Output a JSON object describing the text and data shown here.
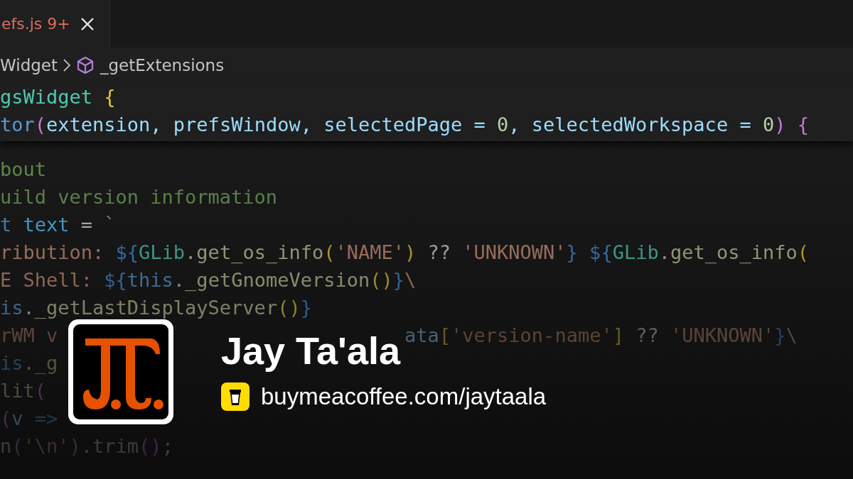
{
  "editor": {
    "tab": {
      "label": "efs.js 9+",
      "selected": true
    },
    "breadcrumb": [
      {
        "label": "Widget"
      },
      {
        "label": "_getExtensions"
      }
    ],
    "sticky_lines": [
      [
        {
          "text": "gsWidget ",
          "kind": "class"
        },
        {
          "text": "{",
          "kind": "brace"
        }
      ],
      [
        {
          "text": "tor",
          "kind": "keyword"
        },
        {
          "text": "(",
          "kind": "paren"
        },
        {
          "text": "extension, prefsWindow, selectedPage = ",
          "kind": "var"
        },
        {
          "text": "0",
          "kind": "num"
        },
        {
          "text": ", selectedWorkspace = ",
          "kind": "var"
        },
        {
          "text": "0",
          "kind": "num"
        },
        {
          "text": ") {",
          "kind": "paren"
        }
      ]
    ],
    "lines": [
      {
        "tokens": [
          {
            "text": "bout",
            "kind": "comment"
          }
        ]
      },
      {
        "tokens": [
          {
            "text": "uild version information",
            "kind": "comment"
          }
        ]
      },
      {
        "tokens": [
          {
            "text": "t",
            "kind": "keyword"
          },
          {
            "text": " text",
            "kind": "const"
          },
          {
            "text": " = ",
            "kind": "plain"
          },
          {
            "text": "`",
            "kind": "string"
          }
        ]
      },
      {
        "tokens": [
          {
            "text": "ribution: ",
            "kind": "string"
          },
          {
            "text": "${",
            "kind": "tmpl"
          },
          {
            "text": "GLib",
            "kind": "class"
          },
          {
            "text": ".get_os_info",
            "kind": "func"
          },
          {
            "text": "(",
            "kind": "brace"
          },
          {
            "text": "'NAME'",
            "kind": "string"
          },
          {
            "text": ")",
            "kind": "brace"
          },
          {
            "text": " ?? ",
            "kind": "plain"
          },
          {
            "text": "'UNKNOWN'",
            "kind": "string"
          },
          {
            "text": "} ${",
            "kind": "tmpl"
          },
          {
            "text": "GLib",
            "kind": "class"
          },
          {
            "text": ".get_os_info",
            "kind": "func"
          },
          {
            "text": "(",
            "kind": "brace"
          }
        ]
      },
      {
        "tokens": [
          {
            "text": "E Shell: ",
            "kind": "string"
          },
          {
            "text": "${",
            "kind": "tmpl"
          },
          {
            "text": "this",
            "kind": "keyword"
          },
          {
            "text": "._getGnomeVersion",
            "kind": "func"
          },
          {
            "text": "()",
            "kind": "brace"
          },
          {
            "text": "}",
            "kind": "tmpl"
          },
          {
            "text": "\\",
            "kind": "string"
          }
        ]
      },
      {
        "tokens": [
          {
            "text": "is",
            "kind": "keyword"
          },
          {
            "text": "._getLastDisplayServer",
            "kind": "func"
          },
          {
            "text": "()",
            "kind": "brace"
          },
          {
            "text": "}",
            "kind": "tmpl"
          }
        ]
      },
      {
        "tokens": [
          {
            "text": "rWM v",
            "kind": "string"
          }
        ],
        "right": [
          {
            "text": "ata",
            "kind": "var"
          },
          {
            "text": "[",
            "kind": "brace"
          },
          {
            "text": "'version-name'",
            "kind": "string"
          },
          {
            "text": "]",
            "kind": "brace"
          },
          {
            "text": " ?? ",
            "kind": "plain"
          },
          {
            "text": "'UNKNOWN'",
            "kind": "string"
          },
          {
            "text": "}",
            "kind": "tmpl"
          },
          {
            "text": "\\",
            "kind": "string"
          }
        ]
      },
      {
        "tokens": [
          {
            "text": "is",
            "kind": "keyword"
          },
          {
            "text": "._g",
            "kind": "func"
          }
        ]
      },
      {
        "tokens": [
          {
            "text": "lit",
            "kind": "func"
          },
          {
            "text": "(",
            "kind": "paren"
          }
        ]
      },
      {
        "tokens": [
          {
            "text": "(",
            "kind": "paren"
          },
          {
            "text": "v ",
            "kind": "var"
          },
          {
            "text": "=>",
            "kind": "keyword"
          }
        ]
      },
      {
        "tokens": [
          {
            "text": "n",
            "kind": "func"
          },
          {
            "text": "(",
            "kind": "paren"
          },
          {
            "text": "'\\n'",
            "kind": "string"
          },
          {
            "text": ")",
            "kind": "paren"
          },
          {
            "text": ".trim",
            "kind": "func"
          },
          {
            "text": "()",
            "kind": "paren"
          },
          {
            "text": ";",
            "kind": "plain"
          }
        ]
      }
    ]
  },
  "profile": {
    "name": "Jay Ta'ala",
    "link": "buymeacoffee.com/jaytaala"
  }
}
